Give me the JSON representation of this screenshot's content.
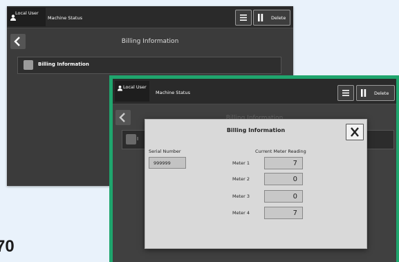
{
  "back_screen": {
    "user_label": "Local User",
    "status_label": "Machine Status",
    "delete_label": "Delete",
    "title": "Billing Information",
    "row_label": "Billing Information"
  },
  "front_screen": {
    "user_label": "Local User",
    "status_label": "Machine Status",
    "delete_label": "Delete",
    "title": "Billing Information",
    "row_fragment": "I"
  },
  "modal": {
    "title": "Billing Information",
    "serial_label": "Serial Number",
    "serial_value": "999999",
    "current_reading_label": "Current Meter Reading",
    "meters": [
      {
        "label": "Meter 1",
        "value": "7"
      },
      {
        "label": "Meter 2",
        "value": "0"
      },
      {
        "label": "Meter 3",
        "value": "0"
      },
      {
        "label": "Meter 4",
        "value": "7"
      }
    ]
  },
  "corner_text": "70",
  "colors": {
    "frame_accent": "#1fa56d",
    "screen_bg": "#3b3b3b",
    "modal_bg": "#d9d9d9"
  }
}
